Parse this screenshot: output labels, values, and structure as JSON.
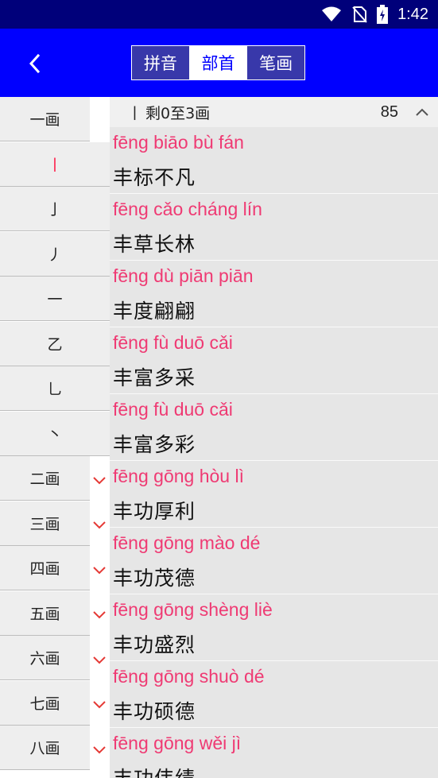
{
  "status_bar": {
    "time": "1:42",
    "icons": [
      "wifi-icon",
      "no-sim-icon",
      "battery-charging-icon"
    ]
  },
  "app_bar": {
    "back_icon": "chevron-left-icon",
    "tabs": [
      {
        "label": "拼音",
        "active": false
      },
      {
        "label": "部首",
        "active": true
      },
      {
        "label": "笔画",
        "active": false
      }
    ]
  },
  "sidebar": {
    "items": [
      {
        "label": "一画",
        "type": "group",
        "expanded": true
      },
      {
        "label": "丨",
        "type": "sub",
        "selected": true
      },
      {
        "label": "亅",
        "type": "sub"
      },
      {
        "label": "丿",
        "type": "sub"
      },
      {
        "label": "一",
        "type": "sub"
      },
      {
        "label": "乙",
        "type": "sub"
      },
      {
        "label": "乚",
        "type": "sub"
      },
      {
        "label": "丶",
        "type": "sub"
      },
      {
        "label": "二画",
        "type": "group",
        "expanded": false
      },
      {
        "label": "三画",
        "type": "group",
        "expanded": false
      },
      {
        "label": "四画",
        "type": "group",
        "expanded": false
      },
      {
        "label": "五画",
        "type": "group",
        "expanded": false
      },
      {
        "label": "六画",
        "type": "group",
        "expanded": false
      },
      {
        "label": "七画",
        "type": "group",
        "expanded": false
      },
      {
        "label": "八画",
        "type": "group",
        "expanded": false
      }
    ]
  },
  "list_header": {
    "radical": "丨",
    "range": "剩0至3画",
    "count": "85"
  },
  "words": [
    {
      "pinyin": "fēng biāo bù fán",
      "hanzi": "丰标不凡"
    },
    {
      "pinyin": "fēng cǎo cháng lín",
      "hanzi": "丰草长林"
    },
    {
      "pinyin": "fēng dù piān piān",
      "hanzi": "丰度翩翩"
    },
    {
      "pinyin": "fēng fù duō cǎi",
      "hanzi": "丰富多采"
    },
    {
      "pinyin": "fēng fù duō cǎi",
      "hanzi": "丰富多彩"
    },
    {
      "pinyin": "fēng gōng hòu lì",
      "hanzi": "丰功厚利"
    },
    {
      "pinyin": "fēng gōng mào dé",
      "hanzi": "丰功茂德"
    },
    {
      "pinyin": "fēng gōng shèng liè",
      "hanzi": "丰功盛烈"
    },
    {
      "pinyin": "fēng gōng shuò dé",
      "hanzi": "丰功硕德"
    },
    {
      "pinyin": "fēng gōng wěi jì",
      "hanzi": "丰功伟绩"
    }
  ],
  "colors": {
    "app_bar": "#0000ff",
    "status_bar": "#00007a",
    "pinyin": "#ef3a73",
    "accent_red": "#ff1744"
  }
}
